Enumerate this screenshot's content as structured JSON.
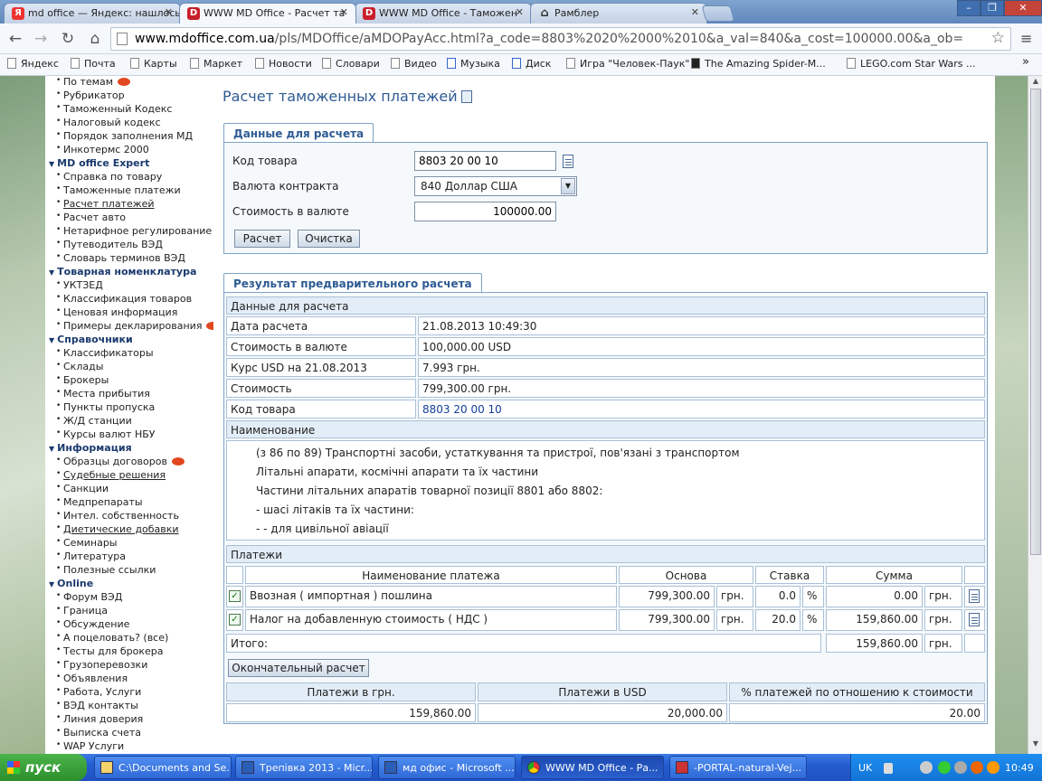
{
  "browser": {
    "tabs": [
      {
        "label": "md office — Яндекс: нашлось",
        "icon": "yandex-icon"
      },
      {
        "label": "WWW MD Office - Расчет та",
        "icon": "mdoffice-icon"
      },
      {
        "label": "WWW MD Office - Таможен",
        "icon": "mdoffice-icon"
      },
      {
        "label": "Рамблер",
        "icon": "home-icon"
      }
    ],
    "url_host": "www.mdoffice.com.ua",
    "url_rest": "/pls/MDOffice/aMDOPayAcc.html?a_code=8803%2020%2000%2010&a_val=840&a_cost=100000.00&a_ob=",
    "bookmarks": [
      "Яндекс",
      "Почта",
      "Карты",
      "Маркет",
      "Новости",
      "Словари",
      "Видео",
      "Музыка",
      "Диск",
      "Игра \"Человек-Паук\"",
      "The Amazing Spider-M...",
      "LEGO.com Star Wars ..."
    ],
    "bookmarks_more": "»"
  },
  "sidebar": {
    "rows": [
      {
        "type": "item",
        "label": "По темам",
        "hot": true
      },
      {
        "type": "item",
        "label": "Рубрикатор"
      },
      {
        "type": "item",
        "label": "Таможенный Кодекс"
      },
      {
        "type": "item",
        "label": "Налоговый кодекс"
      },
      {
        "type": "item",
        "label": "Порядок заполнения МД"
      },
      {
        "type": "item",
        "label": "Инкотермс 2000"
      },
      {
        "type": "head",
        "label": "MD office Expert"
      },
      {
        "type": "item",
        "label": "Справка по товару"
      },
      {
        "type": "item",
        "label": "Таможенные платежи"
      },
      {
        "type": "item",
        "label": "Расчет платежей",
        "underline": true
      },
      {
        "type": "item",
        "label": "Расчет авто"
      },
      {
        "type": "item",
        "label": "Нетарифное регулирование"
      },
      {
        "type": "item",
        "label": "Путеводитель ВЭД"
      },
      {
        "type": "item",
        "label": "Словарь терминов ВЭД"
      },
      {
        "type": "head",
        "label": "Товарная номенклатура"
      },
      {
        "type": "item",
        "label": "УКТЗЕД"
      },
      {
        "type": "item",
        "label": "Классификация товаров"
      },
      {
        "type": "item",
        "label": "Ценовая информация"
      },
      {
        "type": "item",
        "label": "Примеры декларирования",
        "hot": true
      },
      {
        "type": "head",
        "label": "Справочники"
      },
      {
        "type": "item",
        "label": "Классификаторы"
      },
      {
        "type": "item",
        "label": "Склады"
      },
      {
        "type": "item",
        "label": "Брокеры"
      },
      {
        "type": "item",
        "label": "Места прибытия"
      },
      {
        "type": "item",
        "label": "Пункты пропуска"
      },
      {
        "type": "item",
        "label": "Ж/Д станции"
      },
      {
        "type": "item",
        "label": "Курсы валют НБУ"
      },
      {
        "type": "head",
        "label": "Информация"
      },
      {
        "type": "item",
        "label": "Образцы договоров",
        "hot": true
      },
      {
        "type": "item",
        "label": "Судебные решения",
        "underline": true
      },
      {
        "type": "item",
        "label": "Санкции"
      },
      {
        "type": "item",
        "label": "Медпрепараты"
      },
      {
        "type": "item",
        "label": "Интел. собственность"
      },
      {
        "type": "item",
        "label": "Диетические добавки",
        "underline": true
      },
      {
        "type": "item",
        "label": "Семинары"
      },
      {
        "type": "item",
        "label": "Литература"
      },
      {
        "type": "item",
        "label": "Полезные ссылки"
      },
      {
        "type": "head",
        "label": "Online"
      },
      {
        "type": "item",
        "label": "Форум ВЭД"
      },
      {
        "type": "item",
        "label": "Граница"
      },
      {
        "type": "item",
        "label": "Обсуждение"
      },
      {
        "type": "item",
        "label": "А поцеловать? (все)"
      },
      {
        "type": "item",
        "label": "Тесты для брокера"
      },
      {
        "type": "item",
        "label": "Грузоперевозки"
      },
      {
        "type": "item",
        "label": "Объявления"
      },
      {
        "type": "item",
        "label": "Работа, Услуги"
      },
      {
        "type": "item",
        "label": "ВЭД контакты"
      },
      {
        "type": "item",
        "label": "Линия доверия"
      },
      {
        "type": "item",
        "label": "Выписка счета"
      },
      {
        "type": "item",
        "label": "WAP Услуги"
      }
    ]
  },
  "page": {
    "title": "Расчет таможенных платежей",
    "input_section": {
      "tab": "Данные для расчета",
      "code_label": "Код товара",
      "code_value": "8803 20 00 10",
      "currency_label": "Валюта контракта",
      "currency_value": "840 Доллар США",
      "cost_label": "Стоимость в валюте",
      "cost_value": "100000.00",
      "calc_button": "Расчет",
      "clear_button": "Очистка"
    },
    "result_section": {
      "tab": "Результат предварительного расчета",
      "data_header": "Данные для расчета",
      "rows": [
        {
          "label": "Дата расчета",
          "value": "21.08.2013 10:49:30"
        },
        {
          "label": "Стоимость в валюте",
          "value": "100,000.00 USD"
        },
        {
          "label": "Курс USD на 21.08.2013",
          "value": "7.993 грн."
        },
        {
          "label": "Стоимость",
          "value": "799,300.00 грн."
        },
        {
          "label": "Код товара",
          "value": "8803 20 00 10"
        }
      ],
      "name_header": "Наименование",
      "name_lines": [
        "(з 86 по 89) Транспортні засоби, устаткування та пристрої, пов'язані з транспортом",
        "Літальні апарати, космічні апарати та їх частини",
        "Частини літальних апаратів товарної позиції 8801 або 8802:",
        "- шасі літаків та їх частини:",
        "- - для цивільної авіації"
      ],
      "payments_header": "Платежи",
      "columns": {
        "name": "Наименование платежа",
        "base": "Основа",
        "rate": "Ставка",
        "sum": "Сумма"
      },
      "payments": [
        {
          "name": "Ввозная ( импортная ) пошлина",
          "base": "799,300.00",
          "base_unit": "грн.",
          "rate": "0.0",
          "rate_unit": "%",
          "sum": "0.00",
          "sum_unit": "грн."
        },
        {
          "name": "Налог на добавленную стоимость ( НДС )",
          "base": "799,300.00",
          "base_unit": "грн.",
          "rate": "20.0",
          "rate_unit": "%",
          "sum": "159,860.00",
          "sum_unit": "грн."
        }
      ],
      "total_label": "Итого:",
      "total_value": "159,860.00",
      "total_unit": "грн.",
      "final_button": "Окончательный расчет",
      "summary_headers": [
        "Платежи в грн.",
        "Платежи в USD",
        "% платежей по отношению к стоимости"
      ],
      "summary_values": [
        "159,860.00",
        "20,000.00",
        "20.00"
      ]
    }
  },
  "taskbar": {
    "start": "пуск",
    "tasks": [
      "C:\\Documents and Se...",
      "Трепівка 2013 - Micr...",
      "мд офис - Microsoft ...",
      "WWW MD Office - Ра...",
      "-PORTAL-natural-Vej..."
    ],
    "lang": "UK",
    "clock": "10:49"
  }
}
